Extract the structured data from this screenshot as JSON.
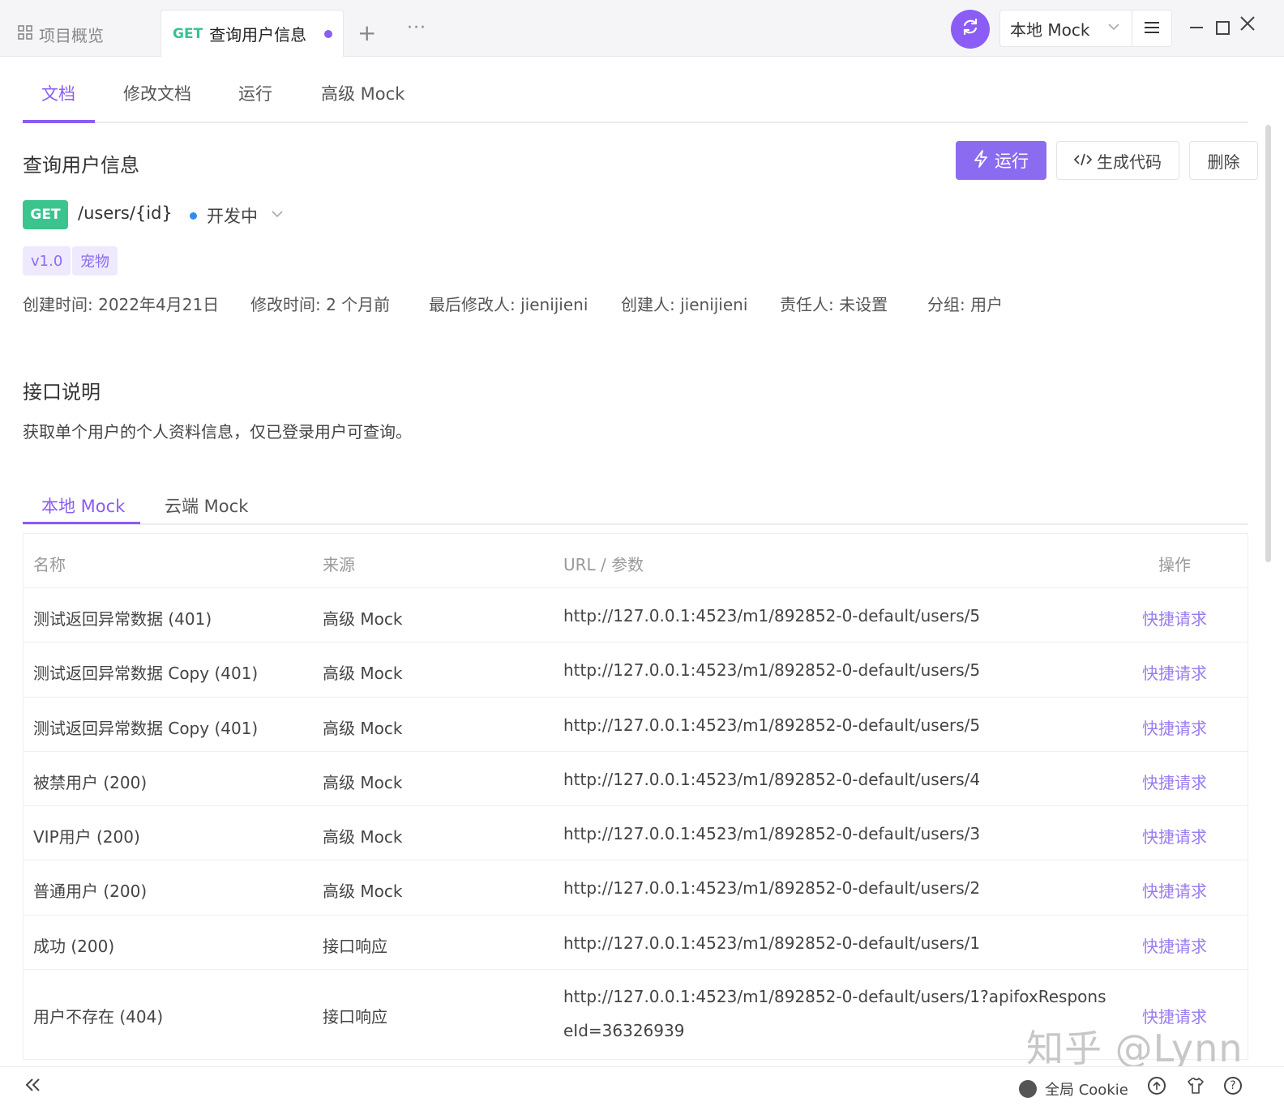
{
  "topbar": {
    "overview_label": "项目概览",
    "active_tab_method": "GET",
    "active_tab_title": "查询用户信息",
    "plus": "+",
    "more": "···",
    "env_label": "本地 Mock",
    "accent": "#8b5cf6"
  },
  "subnav": {
    "items": [
      "文档",
      "修改文档",
      "运行",
      "高级 Mock"
    ]
  },
  "header": {
    "title": "查询用户信息",
    "run_label": "运行",
    "code_label": "生成代码",
    "delete_label": "删除",
    "method": "GET",
    "path": "/users/{id}",
    "status": "开发中",
    "status_color": "#2f8cf0"
  },
  "tags": [
    "v1.0",
    "宠物"
  ],
  "meta": {
    "created": "创建时间: 2022年4月21日",
    "modified": "修改时间: 2 个月前",
    "last_modifier": "最后修改人: jienijieni",
    "creator": "创建人: jienijieni",
    "owner": "责任人: 未设置",
    "group": "分组: 用户"
  },
  "description": {
    "title": "接口说明",
    "text": "获取单个用户的个人资料信息，仅已登录用户可查询。"
  },
  "mock_tabs": [
    "本地 Mock",
    "云端 Mock"
  ],
  "table": {
    "headers": [
      "名称",
      "来源",
      "URL / 参数",
      "操作"
    ],
    "rows": [
      {
        "name": "测试返回异常数据 (401)",
        "source": "高级 Mock",
        "url": "http://127.0.0.1:4523/m1/892852-0-default/users/5",
        "action": "快捷请求"
      },
      {
        "name": "测试返回异常数据 Copy (401)",
        "source": "高级 Mock",
        "url": "http://127.0.0.1:4523/m1/892852-0-default/users/5",
        "action": "快捷请求"
      },
      {
        "name": "测试返回异常数据 Copy (401)",
        "source": "高级 Mock",
        "url": "http://127.0.0.1:4523/m1/892852-0-default/users/5",
        "action": "快捷请求"
      },
      {
        "name": "被禁用户 (200)",
        "source": "高级 Mock",
        "url": "http://127.0.0.1:4523/m1/892852-0-default/users/4",
        "action": "快捷请求"
      },
      {
        "name": "VIP用户 (200)",
        "source": "高级 Mock",
        "url": "http://127.0.0.1:4523/m1/892852-0-default/users/3",
        "action": "快捷请求"
      },
      {
        "name": "普通用户 (200)",
        "source": "高级 Mock",
        "url": "http://127.0.0.1:4523/m1/892852-0-default/users/2",
        "action": "快捷请求"
      },
      {
        "name": "成功 (200)",
        "source": "接口响应",
        "url": "http://127.0.0.1:4523/m1/892852-0-default/users/1",
        "action": "快捷请求"
      },
      {
        "name": "用户不存在 (404)",
        "source": "接口响应",
        "url": "http://127.0.0.1:4523/m1/892852-0-default/users/1?apifoxResponseId=36326939",
        "action": "快捷请求"
      }
    ]
  },
  "watermark": "知乎 @Lynn",
  "footer": {
    "cookie_label": "全局 Cookie"
  }
}
